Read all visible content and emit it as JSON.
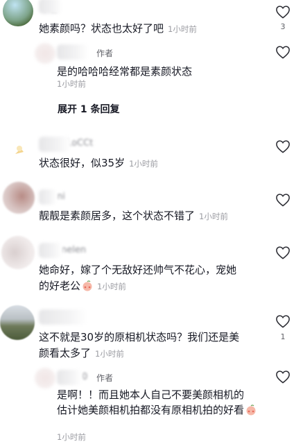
{
  "comments": [
    {
      "id": "c1",
      "text": "她素颜吗？状态也太好了吧",
      "time": "1小时前",
      "likes": "3"
    },
    {
      "id": "r1",
      "author_tag": "作者",
      "text": "是的哈哈哈经常都是素颜状态",
      "time": "1小时前",
      "expand_label": "展开 1 条回复"
    },
    {
      "id": "c2",
      "text": "状态很好，似35岁",
      "time": "1小时前"
    },
    {
      "id": "c3",
      "text": "靓靓是素颜居多，这个状态不错了",
      "time": "1小时前"
    },
    {
      "id": "c4",
      "text_line1": "她命好，嫁了个无敌好还帅气不花心，宠她",
      "text_line2": "的好老公",
      "time": "1小时前",
      "emoji": "blushing-peach-emoji"
    },
    {
      "id": "c5",
      "text_line1": "这不就是30岁的原相机状态吗？我们还是美",
      "text_line2": "颜看太多了",
      "time": "1小时前",
      "likes": "1"
    },
    {
      "id": "r2",
      "author_tag": "作者",
      "text_line1": "是啊！！而且她本人自己不要美颜相机的",
      "text_line2": "估计她美颜相机拍都没有原相机拍的好看",
      "time": "1小时前",
      "emoji": "blushing-peach-emoji"
    }
  ],
  "blurred_names": {
    "c1": "ㄔ它",
    "c2": "LoCCt",
    "c3": "ni",
    "c4": "nelen",
    "r2": "0"
  },
  "colors": {
    "text": "#161823",
    "meta": "#9a9ba1",
    "icon": "#2b2c33"
  }
}
